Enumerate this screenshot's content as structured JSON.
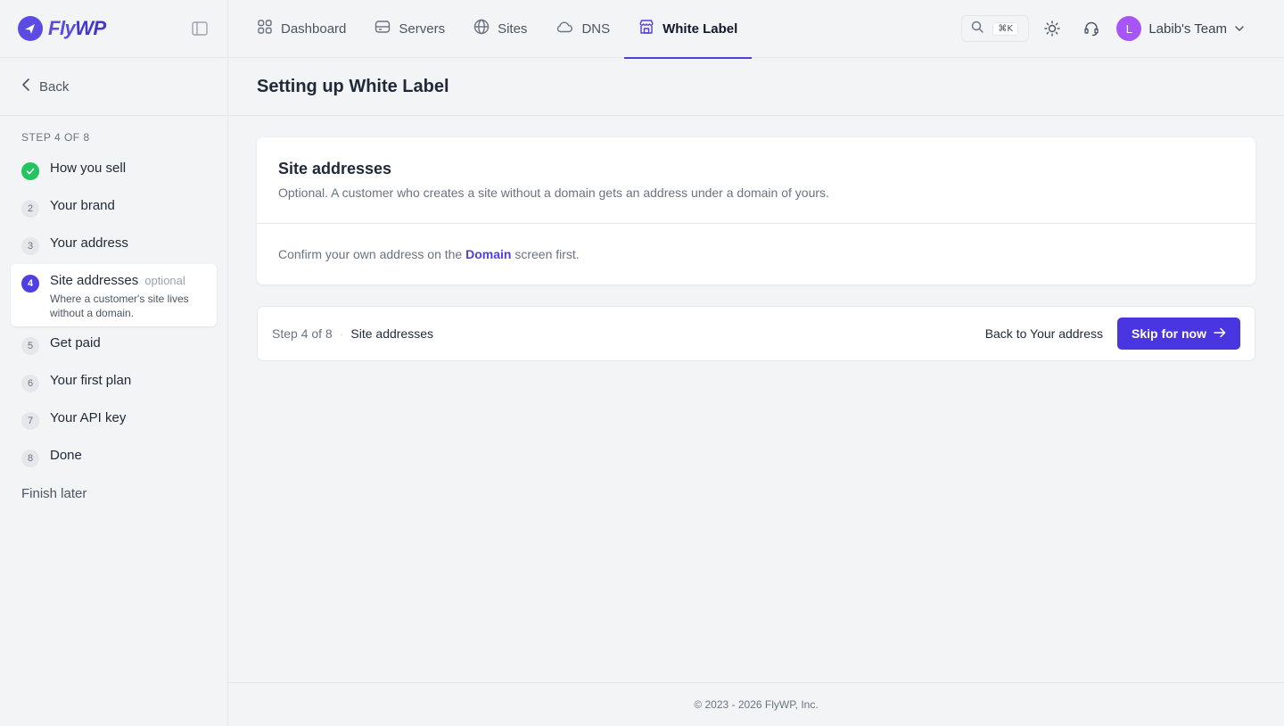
{
  "brand": {
    "name_part1": "Fly",
    "name_part2": "WP"
  },
  "sidebar": {
    "back_label": "Back",
    "step_heading": "STEP 4 OF 8",
    "steps": [
      {
        "number": "✓",
        "label": "How you sell",
        "status": "done"
      },
      {
        "number": "2",
        "label": "Your brand",
        "status": "todo"
      },
      {
        "number": "3",
        "label": "Your address",
        "status": "todo"
      },
      {
        "number": "4",
        "label": "Site addresses",
        "optional": "optional",
        "description": "Where a customer's site lives without a domain.",
        "status": "current"
      },
      {
        "number": "5",
        "label": "Get paid",
        "status": "todo"
      },
      {
        "number": "6",
        "label": "Your first plan",
        "status": "todo"
      },
      {
        "number": "7",
        "label": "Your API key",
        "status": "todo"
      },
      {
        "number": "8",
        "label": "Done",
        "status": "todo"
      }
    ],
    "finish_later": "Finish later"
  },
  "nav": {
    "items": [
      {
        "label": "Dashboard",
        "icon": "dashboard-icon"
      },
      {
        "label": "Servers",
        "icon": "server-icon"
      },
      {
        "label": "Sites",
        "icon": "globe-icon"
      },
      {
        "label": "DNS",
        "icon": "cloud-icon"
      },
      {
        "label": "White Label",
        "icon": "store-icon",
        "active": true
      }
    ],
    "search_shortcut": "⌘K",
    "user": {
      "initial": "L",
      "name": "Labib's Team"
    }
  },
  "page": {
    "title": "Setting up White Label"
  },
  "card": {
    "title": "Site addresses",
    "subtitle": "Optional. A customer who creates a site without a domain gets an address under a domain of yours.",
    "body_prefix": "Confirm your own address on the ",
    "body_link": "Domain",
    "body_suffix": " screen first."
  },
  "stepbar": {
    "count": "Step 4 of 8",
    "separator": "·",
    "current": "Site addresses",
    "back_label": "Back to Your address",
    "primary_label": "Skip for now"
  },
  "footer": {
    "text": "© 2023 - 2026 FlyWP, Inc."
  },
  "colors": {
    "accent": "#4f3ee0",
    "success": "#22c55e",
    "avatar": "#a855f7"
  }
}
